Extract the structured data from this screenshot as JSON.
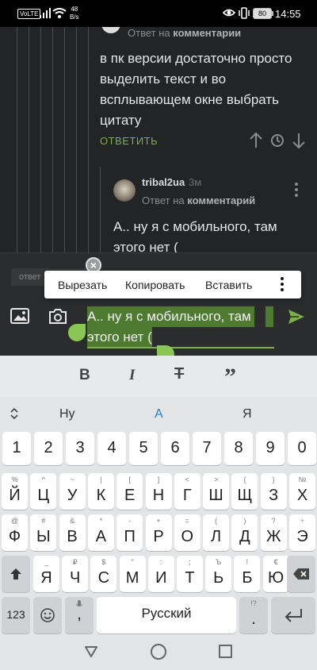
{
  "status_bar": {
    "volte": "VoLTE",
    "net_speed_value": "48",
    "net_speed_unit": "B/s",
    "battery": "80",
    "time": "14:55"
  },
  "comments": {
    "first": {
      "reply_prefix": "Ответ на",
      "reply_target": "комментарии",
      "text": "в пк версии достаточно просто выделить текст и во всплывающем окне выбрать цитату",
      "answer_label": "ОТВЕТИТЬ"
    },
    "second": {
      "username": "tribal2ua",
      "time": "3м",
      "reply_prefix": "Ответ на",
      "reply_target": "комментарий",
      "text": "А.. ну я с мобильного, там этого нет ("
    }
  },
  "composer": {
    "reply_chip": "ответ",
    "text_line1": "А.. ну я с мобильного, там",
    "text_line2": "этого нет ("
  },
  "context_menu": {
    "cut": "Вырезать",
    "copy": "Копировать",
    "paste": "Вставить"
  },
  "format_toolbar": {
    "bold": "B",
    "italic": "I",
    "strike": "T",
    "quote": "”"
  },
  "keyboard": {
    "suggestions": [
      "Ну",
      "А",
      "Я"
    ],
    "rows": [
      [
        {
          "m": "1",
          "s": ""
        },
        {
          "m": "2",
          "s": ""
        },
        {
          "m": "3",
          "s": ""
        },
        {
          "m": "4",
          "s": ""
        },
        {
          "m": "5",
          "s": ""
        },
        {
          "m": "6",
          "s": ""
        },
        {
          "m": "7",
          "s": ""
        },
        {
          "m": "8",
          "s": ""
        },
        {
          "m": "9",
          "s": ""
        },
        {
          "m": "0",
          "s": ""
        }
      ],
      [
        {
          "m": "Й",
          "s": "%"
        },
        {
          "m": "Ц",
          "s": "^"
        },
        {
          "m": "У",
          "s": "~"
        },
        {
          "m": "К",
          "s": "|"
        },
        {
          "m": "Е",
          "s": "["
        },
        {
          "m": "Н",
          "s": "]"
        },
        {
          "m": "Г",
          "s": "<"
        },
        {
          "m": "Ш",
          "s": ">"
        },
        {
          "m": "Щ",
          "s": "{"
        },
        {
          "m": "З",
          "s": "}"
        },
        {
          "m": "Х",
          "s": "№"
        }
      ],
      [
        {
          "m": "Ф",
          "s": "@"
        },
        {
          "m": "Ы",
          "s": "#"
        },
        {
          "m": "В",
          "s": "&"
        },
        {
          "m": "А",
          "s": "*"
        },
        {
          "m": "П",
          "s": "-"
        },
        {
          "m": "Р",
          "s": "+"
        },
        {
          "m": "О",
          "s": "="
        },
        {
          "m": "Л",
          "s": "("
        },
        {
          "m": "Д",
          "s": ")"
        },
        {
          "m": "Ж",
          "s": "?"
        },
        {
          "m": "Э",
          "s": "÷"
        }
      ],
      [
        {
          "m": "Я",
          "s": "_"
        },
        {
          "m": "Ч",
          "s": "₽"
        },
        {
          "m": "С",
          "s": "$"
        },
        {
          "m": "М",
          "s": "\""
        },
        {
          "m": "И",
          "s": ":"
        },
        {
          "m": "Т",
          "s": ";"
        },
        {
          "m": "Ь",
          "s": "Ъ"
        },
        {
          "m": "Б",
          "s": "!"
        },
        {
          "m": "Ю",
          "s": "€"
        }
      ]
    ],
    "num_key": "123",
    "comma": ",",
    "space": "Русский",
    "period": ".",
    "period_sub": "!?"
  }
}
